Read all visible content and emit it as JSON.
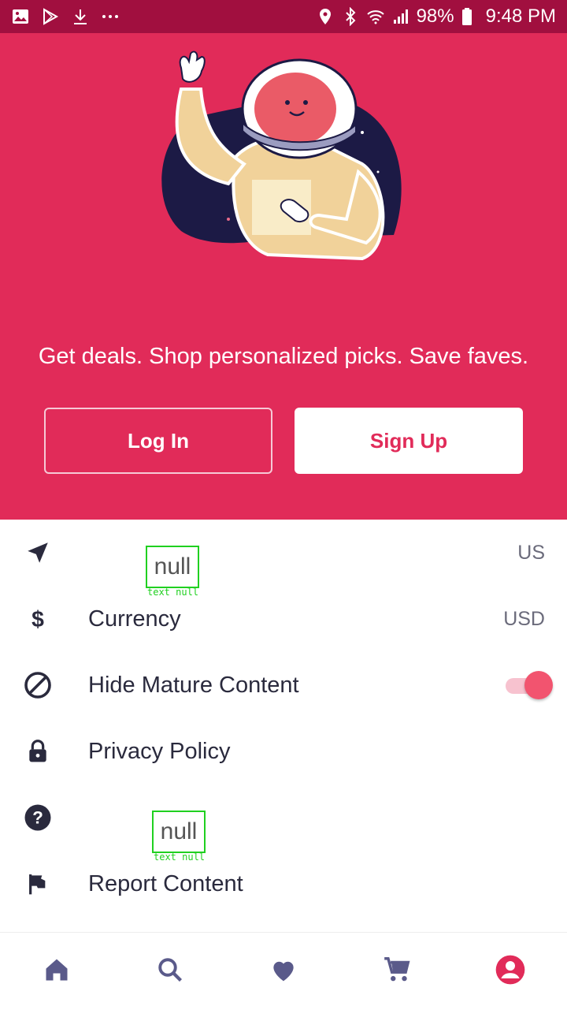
{
  "status_bar": {
    "battery": "98%",
    "time": "9:48 PM",
    "icons": [
      "image-icon",
      "play-store-icon",
      "download-icon",
      "more-dots-icon",
      "location-icon",
      "bluetooth-icon",
      "wifi-icon",
      "signal-icon",
      "battery-icon"
    ]
  },
  "hero": {
    "tagline": "Get deals. Shop personalized picks. Save faves.",
    "login_label": "Log In",
    "signup_label": "Sign Up"
  },
  "settings": {
    "items": [
      {
        "icon": "navigation-arrow-icon",
        "label": "null",
        "value": "US"
      },
      {
        "icon": "dollar-icon",
        "label": "Currency",
        "value": "USD"
      },
      {
        "icon": "block-icon",
        "label": "Hide Mature Content",
        "value": "",
        "toggle": true
      },
      {
        "icon": "lock-icon",
        "label": "Privacy Policy",
        "value": ""
      },
      {
        "icon": "help-circle-icon",
        "label": "null",
        "value": ""
      },
      {
        "icon": "flag-icon",
        "label": "Report Content",
        "value": ""
      }
    ],
    "null_caption": "text null"
  },
  "bottom_nav": [
    "home-icon",
    "search-icon",
    "heart-icon",
    "cart-icon",
    "account-icon"
  ],
  "colors": {
    "brand": "#e12b59",
    "status_bar": "#a10f3f",
    "icon_dark": "#2a2a3d",
    "nav_inactive": "#5a5a8a",
    "nav_active": "#e12b59"
  }
}
